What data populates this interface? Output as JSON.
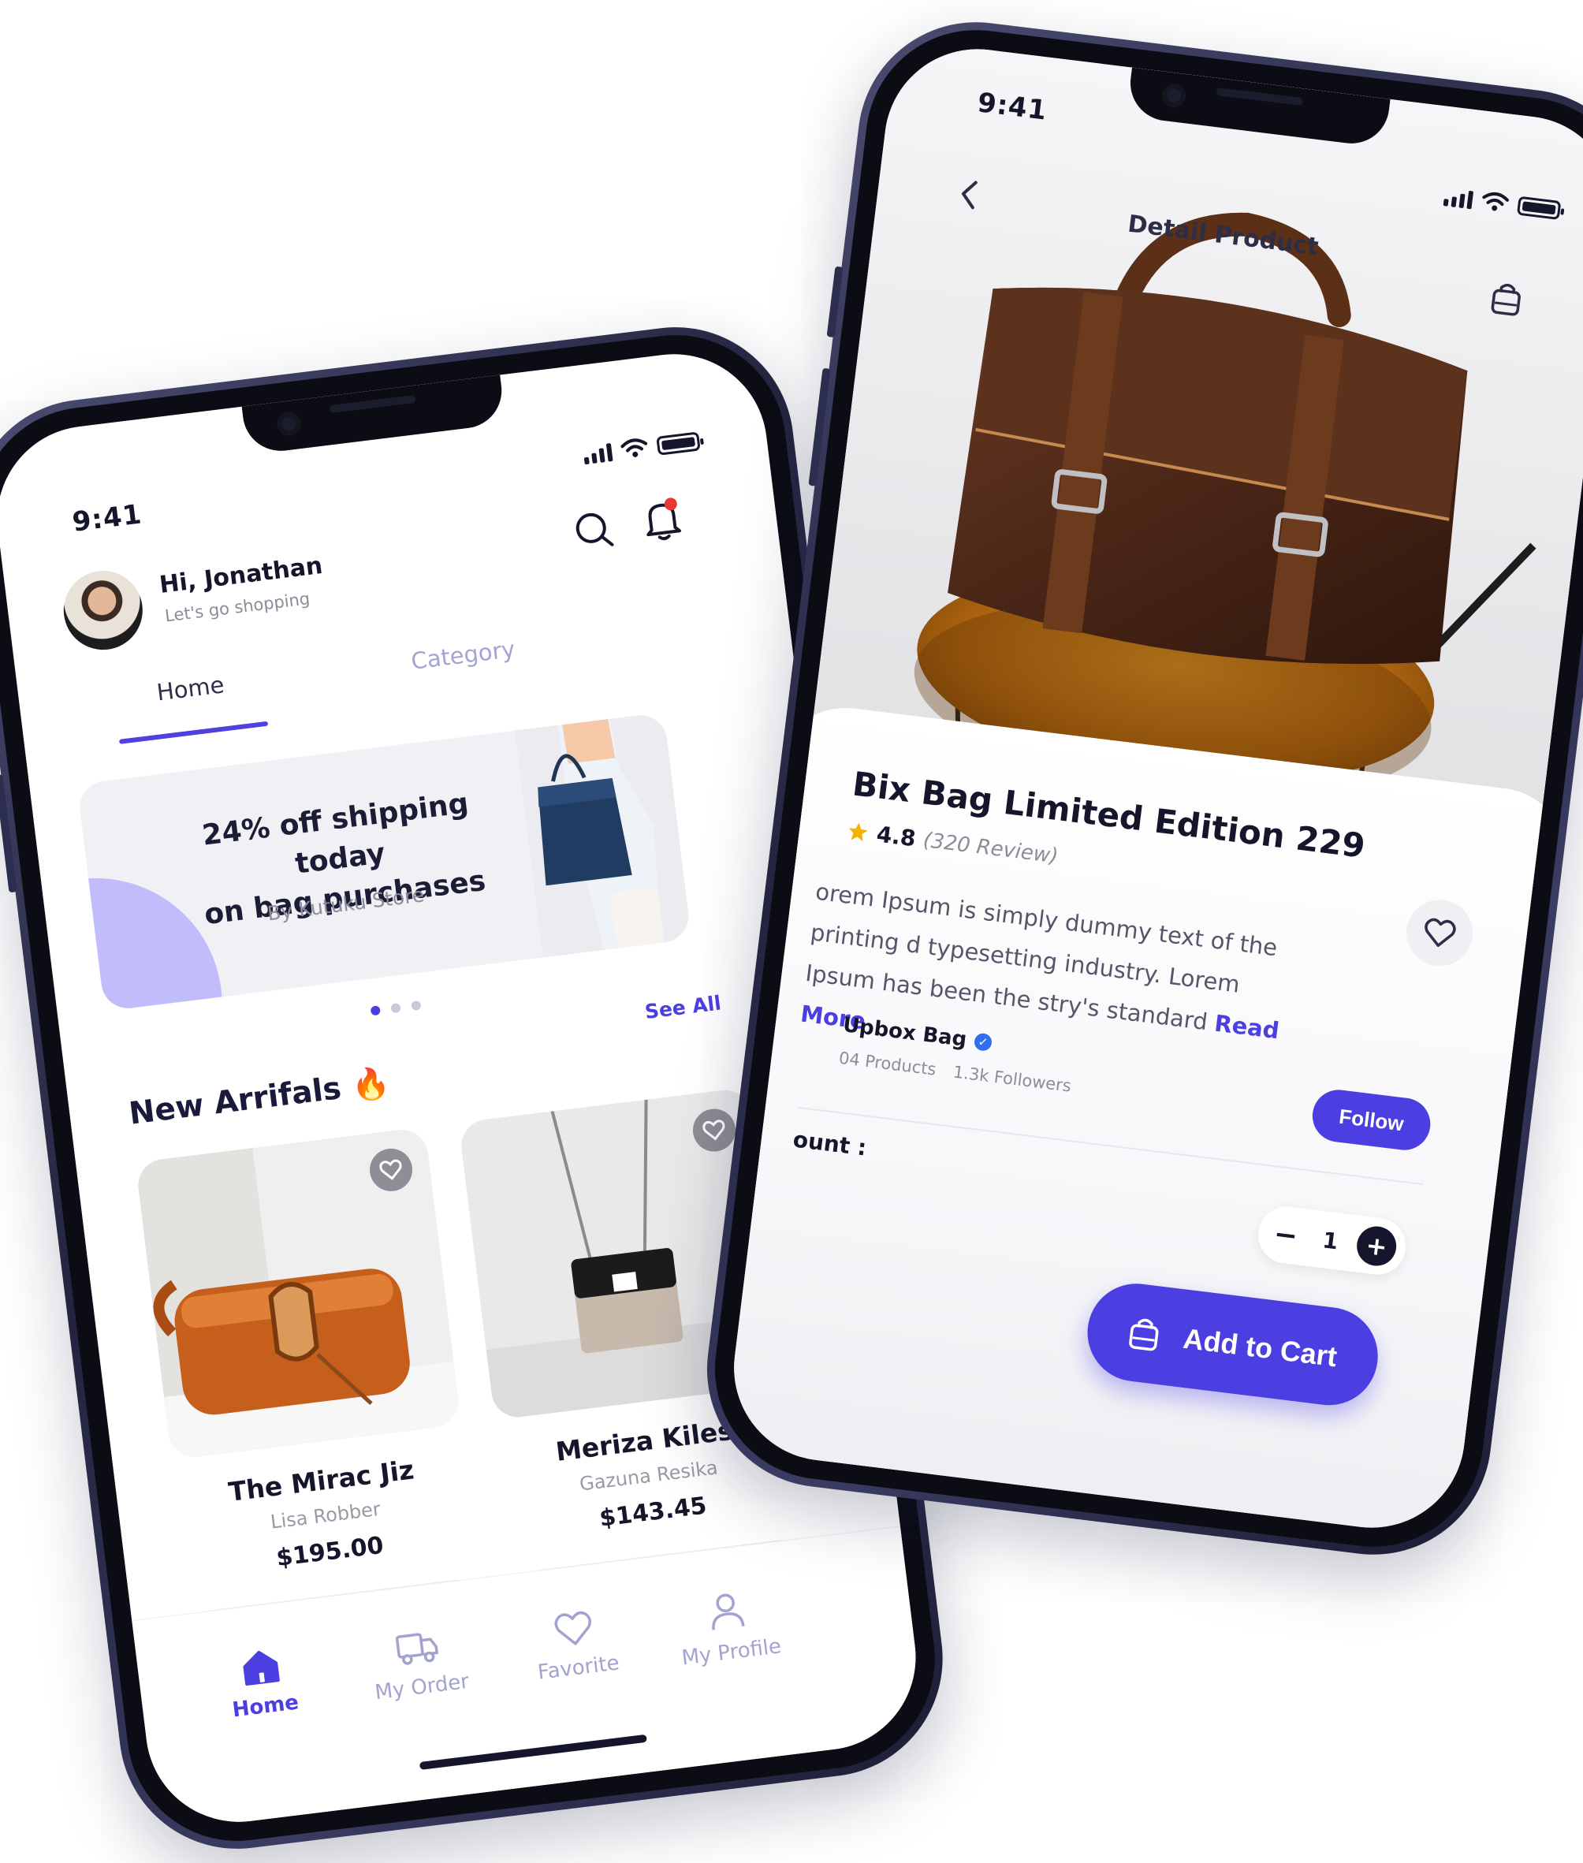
{
  "home": {
    "status_time": "9:41",
    "greeting": "Hi, Jonathan",
    "greeting_sub": "Let's go shopping",
    "tabs": [
      {
        "label": "Home",
        "active": true
      },
      {
        "label": "Category",
        "active": false
      }
    ],
    "banner": {
      "title_line1": "24% off shipping today",
      "title_line2": "on bag purchases",
      "subtitle": "By Kutuku Store",
      "page_count": 3,
      "active_page": 1
    },
    "see_all": "See All",
    "section_title": "New Arrifals 🔥",
    "products": [
      {
        "name": "The Mirac Jiz",
        "brand": "Lisa Robber",
        "price": "$195.00"
      },
      {
        "name": "Meriza Kiles",
        "brand": "Gazuna Resika",
        "price": "$143.45"
      }
    ],
    "nav": [
      {
        "label": "Home",
        "icon": "home-icon",
        "active": true
      },
      {
        "label": "My Order",
        "icon": "truck-icon",
        "active": false
      },
      {
        "label": "Favorite",
        "icon": "heart-icon",
        "active": false
      },
      {
        "label": "My Profile",
        "icon": "user-icon",
        "active": false
      }
    ]
  },
  "detail": {
    "status_time": "9:41",
    "title": "Detail Product",
    "product_title": "Bix Bag Limited Edition 229",
    "rating": "4.8",
    "reviews": "(320 Review)",
    "description": "orem Ipsum is simply dummy text of the printing d typesetting industry. Lorem Ipsum has been the stry's standard",
    "read_more": "Read More",
    "store_name": "Upbox Bag",
    "store_products": "04 Products",
    "store_followers": "1.3k Followers",
    "follow_label": "Follow",
    "amount_label": "ount :",
    "quantity": "1",
    "minus": "−",
    "plus": "+",
    "add_to_cart": "Add to Cart"
  },
  "colors": {
    "accent": "#4b3fe2",
    "banner_blob": "#c1bdfc",
    "text_dark": "#15162b",
    "text_muted": "#8c8d99",
    "notification_dot": "#e53935"
  }
}
